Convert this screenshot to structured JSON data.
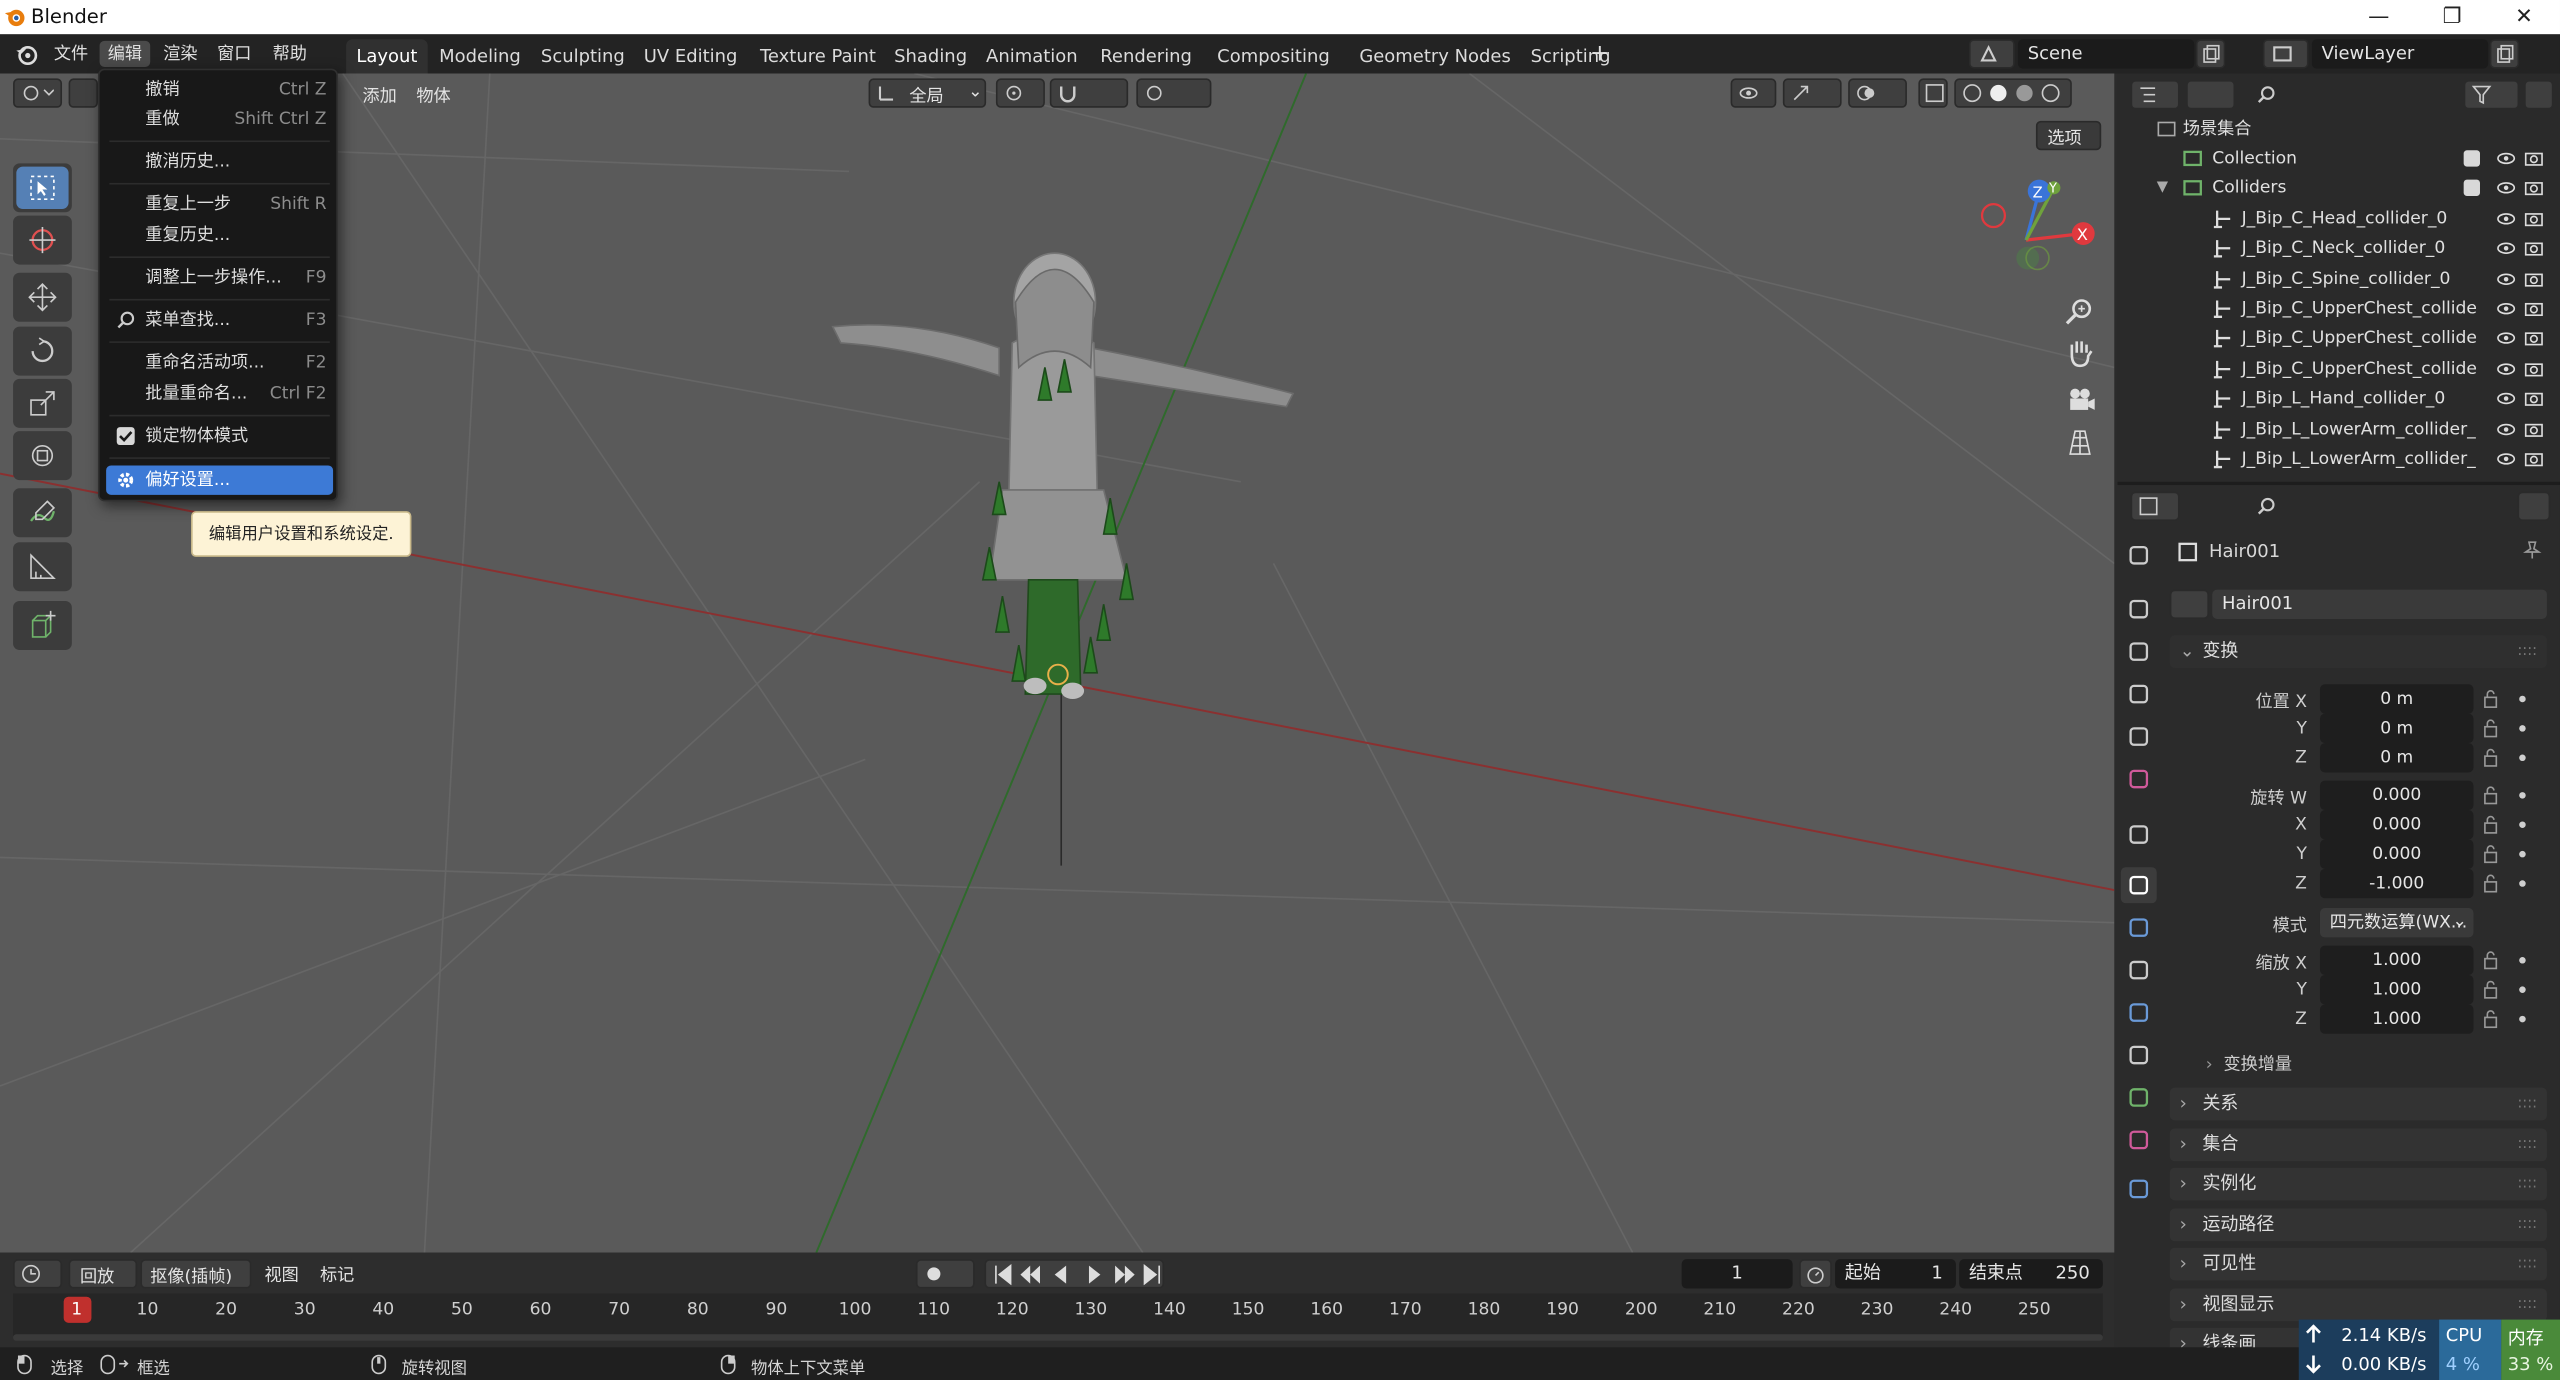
{
  "window": {
    "title": "Blender",
    "minimize": "—",
    "restore": "❐",
    "close": "✕"
  },
  "menubar": {
    "file": "文件",
    "edit": "编辑",
    "render": "渲染",
    "window": "窗口",
    "help": "帮助"
  },
  "workspaces": [
    "Layout",
    "Modeling",
    "Sculpting",
    "UV Editing",
    "Texture Paint",
    "Shading",
    "Animation",
    "Rendering",
    "Compositing",
    "Geometry Nodes",
    "Scripting"
  ],
  "add_workspace": "+",
  "scene": {
    "name": "Scene",
    "view_layer": "ViewLayer"
  },
  "viewport": {
    "add_menu": "添加",
    "object_menu": "物体",
    "orientation": "全局",
    "options_button": "选项",
    "gizmo": {
      "x": "X",
      "y": "Y",
      "z": "Z"
    }
  },
  "edit_menu": {
    "items": [
      {
        "label": "撤销",
        "shortcut": "Ctrl Z"
      },
      {
        "label": "重做",
        "shortcut": "Shift Ctrl Z"
      },
      {
        "label": "撤消历史...",
        "shortcut": ""
      },
      {
        "label": "重复上一步",
        "shortcut": "Shift R"
      },
      {
        "label": "重复历史...",
        "shortcut": ""
      },
      {
        "label": "调整上一步操作...",
        "shortcut": "F9"
      },
      {
        "label": "菜单查找...",
        "shortcut": "F3"
      },
      {
        "label": "重命名活动项...",
        "shortcut": "F2"
      },
      {
        "label": "批量重命名...",
        "shortcut": "Ctrl F2"
      },
      {
        "label": "锁定物体模式",
        "shortcut": ""
      },
      {
        "label": "偏好设置...",
        "shortcut": ""
      }
    ],
    "tooltip": "编辑用户设置和系统设定."
  },
  "outliner": {
    "scene_collection": "场景集合",
    "rows": [
      "Collection",
      "Colliders",
      "J_Bip_C_Head_collider_0",
      "J_Bip_C_Neck_collider_0",
      "J_Bip_C_Spine_collider_0",
      "J_Bip_C_UpperChest_collide",
      "J_Bip_C_UpperChest_collide",
      "J_Bip_C_UpperChest_collide",
      "J_Bip_L_Hand_collider_0",
      "J_Bip_L_LowerArm_collider_",
      "J_Bip_L_LowerArm_collider_"
    ]
  },
  "properties": {
    "object_name": "Hair001",
    "data_name": "Hair001",
    "transform": {
      "title": "变换",
      "location_label": "位置 X",
      "location": [
        "0 m",
        "0 m",
        "0 m"
      ],
      "rotation_label": "旋转 W",
      "rotation": [
        "0.000",
        "0.000",
        "0.000",
        "-1.000"
      ],
      "mode_label": "模式",
      "mode_value": "四元数运算(WX...",
      "scale_label": "缩放 X",
      "scale": [
        "1.000",
        "1.000",
        "1.000"
      ],
      "axis_y": "Y",
      "axis_x": "X",
      "axis_z": "Z",
      "delta": "变换增量"
    },
    "sections": [
      "关系",
      "集合",
      "实例化",
      "运动路径",
      "可见性",
      "视图显示",
      "线条画"
    ]
  },
  "timeline": {
    "playback": "回放",
    "keying": "抠像(插帧)",
    "view": "视图",
    "marker": "标记",
    "current_frame": "1",
    "start_label": "起始",
    "start": "1",
    "end_label": "结束点",
    "end": "250",
    "ticks": [
      "1",
      "10",
      "20",
      "30",
      "40",
      "50",
      "60",
      "70",
      "80",
      "90",
      "100",
      "110",
      "120",
      "130",
      "140",
      "150",
      "160",
      "170",
      "180",
      "190",
      "200",
      "210",
      "220",
      "230",
      "240",
      "250"
    ]
  },
  "statusbar": {
    "select": "选择",
    "box_select": "框选",
    "rotate_view": "旋转视图",
    "context_menu": "物体上下文菜单",
    "upload_speed": "2.14 KB/s",
    "download_speed": "0.00 KB/s",
    "cpu_label": "CPU",
    "cpu_value": "4 %",
    "mem_label": "内存",
    "mem_value": "33 %"
  },
  "colors": {
    "accent": "#3d7ad6",
    "viewport_bg": "#5a5a5a",
    "x_axis": "#e0393e",
    "y_axis": "#6fa23c",
    "z_axis": "#3a74d9"
  }
}
